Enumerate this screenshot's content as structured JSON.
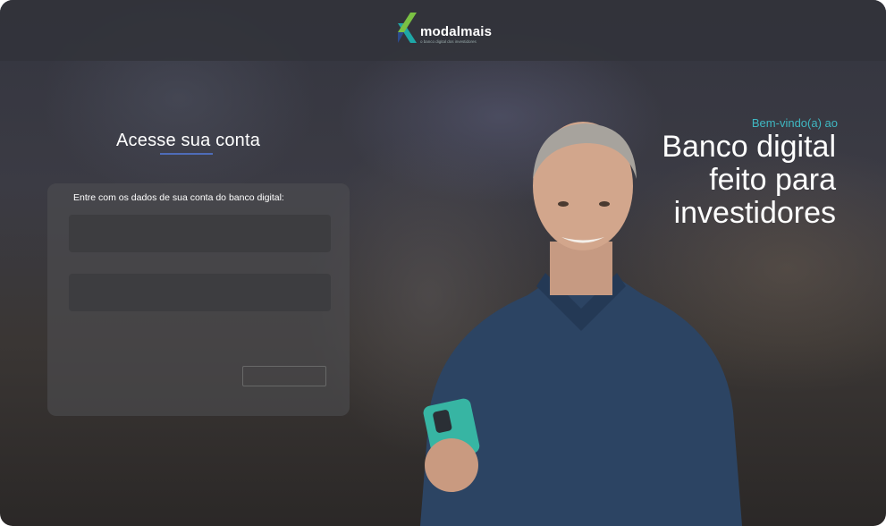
{
  "brand": {
    "name": "modalmais",
    "tagline": "o banco digital dos investidores",
    "icon": "modalmais-logo-icon",
    "colors": {
      "teal": "#1ea7a7",
      "green": "#7ac143",
      "navy": "#2c4a8c"
    }
  },
  "login": {
    "title": "Acesse sua conta",
    "intro": "Entre com os dados de sua conta do banco digital:",
    "field1_placeholder": "",
    "field2_placeholder": "",
    "submit_label": ""
  },
  "hero": {
    "welcome": "Bem-vindo(a) ao",
    "line1": "Banco digital",
    "line2": "feito para",
    "line3": "investidores"
  },
  "colors": {
    "accent_underline": "#4e6cb8",
    "welcome_teal": "#3fb8c2"
  }
}
